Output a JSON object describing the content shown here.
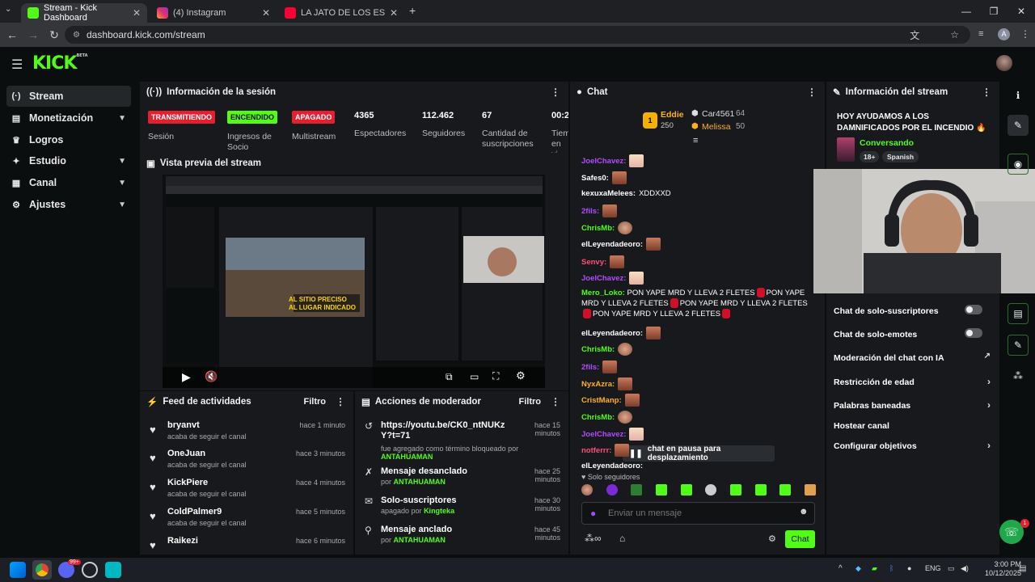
{
  "browser": {
    "tabs": [
      {
        "label": "Stream - Kick Dashboard",
        "icon": "kick-icon",
        "color": "#53fc18",
        "active": true
      },
      {
        "label": "(4) Instagram",
        "icon": "instagram-icon",
        "color": "#e1306c",
        "active": false
      },
      {
        "label": "LA JATO DE LOS ESPECIALES: C",
        "icon": "youtube-icon",
        "color": "#ff0033",
        "active": false
      }
    ],
    "url": "dashboard.kick.com/stream",
    "profile_initial": "A"
  },
  "header": {
    "logo": "KICK",
    "logo_badge": "BETA"
  },
  "sidebar": {
    "items": [
      {
        "label": "Stream",
        "icon": "stream-icon",
        "glyph": "(·)",
        "active": true,
        "chevron": false
      },
      {
        "label": "Monetización",
        "icon": "money-icon",
        "glyph": "▤",
        "active": false,
        "chevron": true
      },
      {
        "label": "Logros",
        "icon": "trophy-icon",
        "glyph": "🏆",
        "active": false,
        "chevron": false
      },
      {
        "label": "Estudio",
        "icon": "studio-icon",
        "glyph": "✦",
        "active": false,
        "chevron": true
      },
      {
        "label": "Canal",
        "icon": "channel-icon",
        "glyph": "▦",
        "active": false,
        "chevron": true
      },
      {
        "label": "Ajustes",
        "icon": "settings-icon",
        "glyph": "⚙",
        "active": false,
        "chevron": true
      }
    ]
  },
  "session": {
    "title": "Información de la sesión",
    "stats": [
      {
        "badge": "TRANSMITIENDO",
        "badge_color": "#e4202f",
        "label": "Sesión"
      },
      {
        "badge": "ENCENDIDO",
        "badge_color": "#53fc18",
        "label": "Ingresos de Socio"
      },
      {
        "badge": "APAGADO",
        "badge_color": "#e4202f",
        "label": "Multistream"
      },
      {
        "num": "4365",
        "label": "Espectadores"
      },
      {
        "num": "112.462",
        "label": "Seguidores"
      },
      {
        "num": "67",
        "label": "Cantidad de suscripciones"
      },
      {
        "num": "00:2",
        "label": "Tiem en vi"
      }
    ]
  },
  "preview": {
    "title": "Vista previa del stream",
    "overlay_text_1": "AL SITIO PRECISO",
    "overlay_text_2": "AL LUGAR INDICADO",
    "progress": 0.0
  },
  "activity": {
    "title": "Feed de actividades",
    "filter": "Filtro",
    "items": [
      {
        "name": "bryanvt",
        "sub": "acaba de seguir el canal",
        "time": "hace 1 minuto"
      },
      {
        "name": "OneJuan",
        "sub": "acaba de seguir el canal",
        "time": "hace 3 minutos"
      },
      {
        "name": "KickPiere",
        "sub": "acaba de seguir el canal",
        "time": "hace 4 minutos"
      },
      {
        "name": "ColdPalmer9",
        "sub": "acaba de seguir el canal",
        "time": "hace 5 minutos"
      },
      {
        "name": "Raikezi",
        "sub": "",
        "time": "hace 6 minutos"
      }
    ]
  },
  "modactions": {
    "title": "Acciones de moderador",
    "filter": "Filtro",
    "items": [
      {
        "icon": "history-icon",
        "glyph": "↺",
        "title": "https://youtu.be/CK0_ntNUKzY?t=71",
        "sub": "fue agregado como término bloqueado por",
        "by": "ANTAHUAMAN",
        "time": "hace 15 minutos"
      },
      {
        "icon": "unpin-icon",
        "glyph": "✗",
        "title": "Mensaje desanclado",
        "sub": "por",
        "by": "ANTAHUAMAN",
        "time": "hace 25 minutos"
      },
      {
        "icon": "gift-icon",
        "glyph": "🎁",
        "title": "Solo-suscriptores",
        "sub": "apagado por",
        "by": "Kingteka",
        "time": "hace 30 minutos"
      },
      {
        "icon": "pin-icon",
        "glyph": "📌",
        "title": "Mensaje anclado",
        "sub": "por",
        "by": "ANTAHUAMAN",
        "time": "hace 45 minutos"
      }
    ]
  },
  "chat": {
    "title": "Chat",
    "leaderboard": [
      {
        "name": "Eddie",
        "points": "250",
        "rank": "1"
      },
      {
        "name": "Car4561",
        "points": "64"
      },
      {
        "name": "Melissa",
        "points": "50"
      }
    ],
    "messages": [
      {
        "user": "JoelChavez:",
        "color": "#b44bff",
        "text": "",
        "emote": "pink"
      },
      {
        "user": "Safes0:",
        "color": "#ffffff",
        "text": "",
        "emote": "brown"
      },
      {
        "user": "kexuxaMelees:",
        "color": "#ffffff",
        "text": "XDDXXD",
        "emote": ""
      },
      {
        "user": "2fils:",
        "color": "#b44bff",
        "text": "",
        "emote": "brown"
      },
      {
        "user": "ChrisMb:",
        "color": "#53fc18",
        "text": "",
        "emote": "round"
      },
      {
        "user": "elLeyendadeoro:",
        "color": "#ffffff",
        "text": "",
        "emote": "brown"
      },
      {
        "user": "Senvy:",
        "color": "#ff4f7a",
        "text": "",
        "emote": "brown"
      },
      {
        "user": "JoelChavez:",
        "color": "#b44bff",
        "text": "",
        "emote": "pink"
      },
      {
        "user": "Mero_Loko:",
        "color": "#53fc18",
        "text": "PON YAPE MRD Y LLEVA 2 FLETES",
        "emote": "spam"
      },
      {
        "user": "elLeyendadeoro:",
        "color": "#ffffff",
        "text": "",
        "emote": "brown"
      },
      {
        "user": "ChrisMb:",
        "color": "#53fc18",
        "text": "",
        "emote": "round"
      },
      {
        "user": "2fils:",
        "color": "#b44bff",
        "text": "",
        "emote": "brown"
      },
      {
        "user": "NyxAzra:",
        "color": "#ffb020",
        "text": "",
        "emote": "brown"
      },
      {
        "user": "CristManp:",
        "color": "#ffb020",
        "text": "",
        "emote": "brown"
      },
      {
        "user": "ChrisMb:",
        "color": "#53fc18",
        "text": "",
        "emote": "round"
      },
      {
        "user": "JoelChavez:",
        "color": "#b44bff",
        "text": "",
        "emote": "pink"
      },
      {
        "user": "notferrr:",
        "color": "#ff4f7a",
        "text": "",
        "emote": "brown"
      },
      {
        "user": "elLeyendadeoro:",
        "color": "#ffffff",
        "text": "",
        "emote": ""
      }
    ],
    "paused": "chat en pausa para desplazamiento",
    "followers_only": "Solo seguidores",
    "input_placeholder": "Enviar un mensaje",
    "send": "Chat"
  },
  "streaminfo": {
    "title": "Información del stream",
    "stream_title": "HOY AYUDAMOS A LOS DAMNIFICADOS POR EL INCENDIO 🔥",
    "category": "Conversando",
    "tags": [
      "18+",
      "Spanish"
    ],
    "settings": [
      {
        "label": "Chat de solo-suscriptores",
        "type": "toggle"
      },
      {
        "label": "Chat de solo-emotes",
        "type": "toggle"
      },
      {
        "label": "Moderación del chat con IA",
        "type": "external"
      },
      {
        "label": "Restricción de edad",
        "type": "chevron"
      },
      {
        "label": "Palabras baneadas",
        "type": "chevron"
      },
      {
        "label": "Hostear canal",
        "type": "none"
      },
      {
        "label": "Configurar objetivos",
        "type": "chevron"
      }
    ]
  },
  "taskbar": {
    "lang": "ENG",
    "time": "3:00 PM",
    "date": "10/12/2025",
    "notif_count": "99+",
    "help_badge": "1"
  }
}
